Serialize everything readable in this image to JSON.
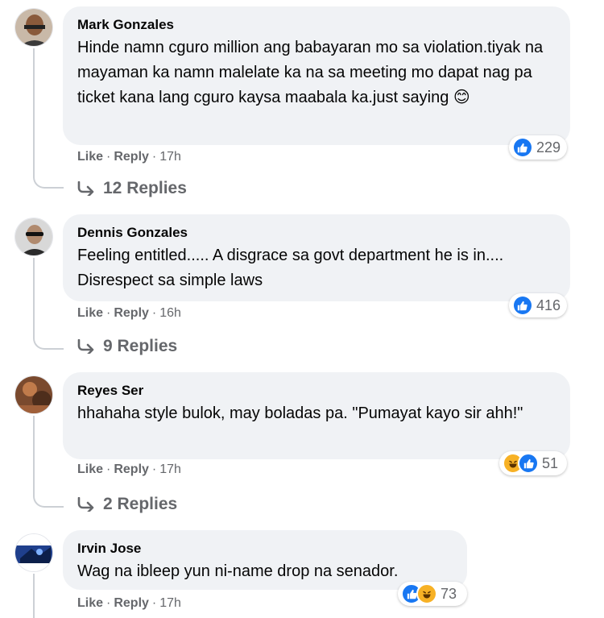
{
  "actions": {
    "like": "Like",
    "reply": "Reply",
    "separator": "·"
  },
  "comments": [
    {
      "author": "Mark Gonzales",
      "text": "Hinde namn cguro million ang babayaran mo sa violation.tiyak na mayaman ka namn malelate ka na sa meeting mo dapat nag pa ticket kana lang cguro kaysa maabala ka.just saying 😊",
      "time": "17h",
      "reactions": [
        "like"
      ],
      "reaction_count": "229",
      "replies": "12 Replies"
    },
    {
      "author": "Dennis Gonzales",
      "text": "Feeling entitled..... A disgrace sa govt department he is in.... Disrespect sa simple laws",
      "time": "16h",
      "reactions": [
        "like"
      ],
      "reaction_count": "416",
      "replies": "9 Replies"
    },
    {
      "author": "Reyes Ser",
      "text": "hhahaha style bulok, may boladas pa. \"Pumayat kayo sir ahh!\"",
      "time": "17h",
      "reactions": [
        "haha",
        "like"
      ],
      "reaction_count": "51",
      "replies": "2 Replies"
    },
    {
      "author": "Irvin Jose",
      "text": "Wag na ibleep yun ni-name drop na senador.",
      "time": "17h",
      "reactions": [
        "like",
        "haha"
      ],
      "reaction_count": "73"
    }
  ],
  "colors": {
    "bubble": "#f0f2f5",
    "meta_text": "#65676b",
    "like_blue": "#1877f2",
    "haha_yellow": "#f7b125",
    "thread_line": "#ccd0d5"
  }
}
